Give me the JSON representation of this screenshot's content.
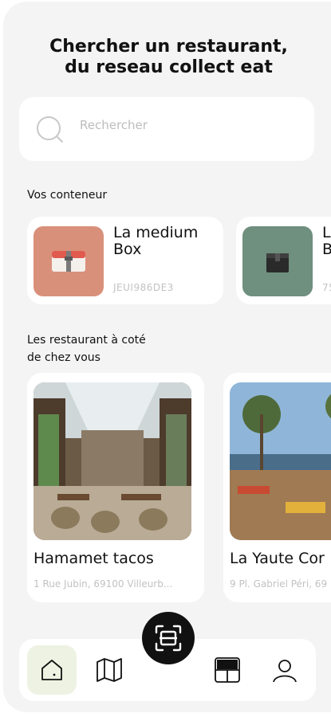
{
  "header": {
    "title_line1": "Chercher un restaurant,",
    "title_line2": "du reseau collect eat"
  },
  "search": {
    "placeholder": "Rechercher",
    "icon": "search-icon"
  },
  "containers": {
    "section_title": "Vos conteneur",
    "items": [
      {
        "name_line1": "La medium",
        "name_line2": "Box",
        "code": "JEUI986DE3",
        "color": "#d9907a"
      },
      {
        "name_line1": "Le",
        "name_line2": "B",
        "code": "75",
        "color": "#6f8f7f"
      }
    ]
  },
  "restaurants": {
    "section_title_line1": "Les restaurant à coté",
    "section_title_line2": "de chez vous",
    "items": [
      {
        "name": "Hamamet tacos",
        "address": "1 Rue Jubin, 69100 Villeurb..."
      },
      {
        "name": "La Yaute Cor",
        "address": "9 Pl. Gabriel Péri, 69"
      }
    ]
  },
  "nav": {
    "items": [
      "home-icon",
      "map-icon",
      "scan-icon",
      "layout-icon",
      "profile-icon"
    ],
    "active": "home-icon",
    "active_bg": "#eef2e3"
  }
}
